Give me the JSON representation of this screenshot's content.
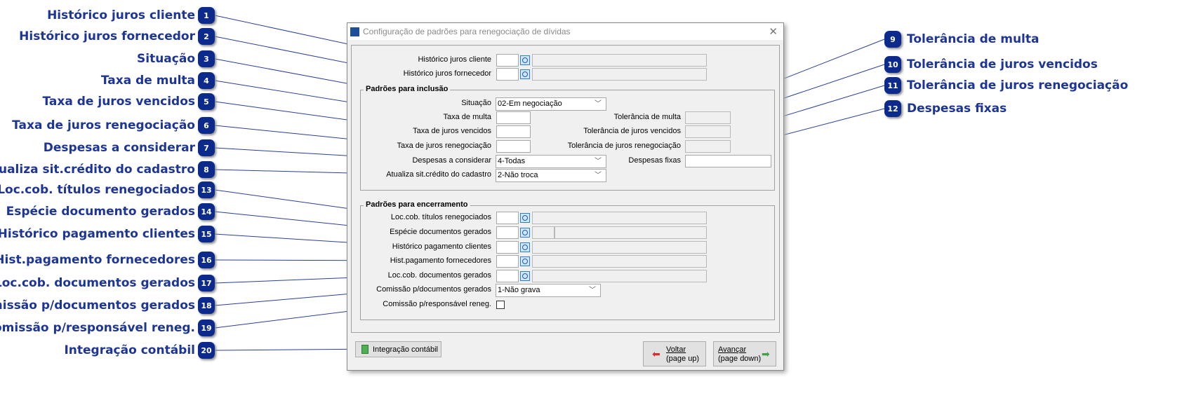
{
  "callouts_left": [
    {
      "n": "1",
      "label": "Histórico juros cliente"
    },
    {
      "n": "2",
      "label": "Histórico juros fornecedor"
    },
    {
      "n": "3",
      "label": "Situação"
    },
    {
      "n": "4",
      "label": "Taxa de multa"
    },
    {
      "n": "5",
      "label": "Taxa de juros vencidos"
    },
    {
      "n": "6",
      "label": "Taxa de juros renegociação"
    },
    {
      "n": "7",
      "label": "Despesas a considerar"
    },
    {
      "n": "8",
      "label": "Atualiza sit.crédito do cadastro"
    },
    {
      "n": "13",
      "label": "Loc.cob. títulos renegociados"
    },
    {
      "n": "14",
      "label": "Espécie documento gerados"
    },
    {
      "n": "15",
      "label": "Histórico pagamento clientes"
    },
    {
      "n": "16",
      "label": "Hist.pagamento fornecedores"
    },
    {
      "n": "17",
      "label": "Loc.cob. documentos gerados"
    },
    {
      "n": "18",
      "label": "Comissão p/documentos gerados"
    },
    {
      "n": "19",
      "label": "Comissão p/responsável reneg."
    },
    {
      "n": "20",
      "label": "Integração contábil"
    }
  ],
  "callouts_right": [
    {
      "n": "9",
      "label": "Tolerância de multa"
    },
    {
      "n": "10",
      "label": "Tolerância de juros vencidos"
    },
    {
      "n": "11",
      "label": "Tolerância de juros renegociação"
    },
    {
      "n": "12",
      "label": "Despesas fixas"
    }
  ],
  "dialog": {
    "title": "Configuração de padrões para renegociação de dívidas",
    "close": "✕",
    "hist_juros_cliente": "Histórico juros cliente",
    "hist_juros_fornecedor": "Histórico juros fornecedor",
    "inclusao": {
      "title": "Padrões para inclusão",
      "situacao_label": "Situação",
      "situacao_value": "02-Em negociação",
      "taxa_multa": "Taxa de multa",
      "taxa_juros_vencidos": "Taxa de juros vencidos",
      "taxa_juros_reneg": "Taxa de juros renegociação",
      "despesas_label": "Despesas a considerar",
      "despesas_value": "4-Todas",
      "atualiza_label": "Atualiza sit.crédito do cadastro",
      "atualiza_value": "2-Não troca",
      "tol_multa": "Tolerância de multa",
      "tol_juros_vencidos": "Tolerância de juros vencidos",
      "tol_juros_reneg": "Tolerância de juros renegociação",
      "despesas_fixas": "Despesas fixas"
    },
    "encerramento": {
      "title": "Padrões para encerramento",
      "loc_titulos": "Loc.cob. títulos renegociados",
      "especie": "Espécie documentos gerados",
      "hist_pag_clientes": "Histórico pagamento clientes",
      "hist_pag_fornecedores": "Hist.pagamento fornecedores",
      "loc_docs": "Loc.cob. documentos gerados",
      "comissao_docs_label": "Comissão p/documentos gerados",
      "comissao_docs_value": "1-Não grava",
      "comissao_resp": "Comissão p/responsável reneg."
    },
    "buttons": {
      "integracao": "Integração contábil",
      "voltar_1": "Voltar",
      "voltar_2": "(page up)",
      "avancar_1": "Avançar",
      "avancar_2": "(page down)"
    }
  },
  "colors": {
    "callout": "#1d3596",
    "badge": "#0b2a8c"
  }
}
